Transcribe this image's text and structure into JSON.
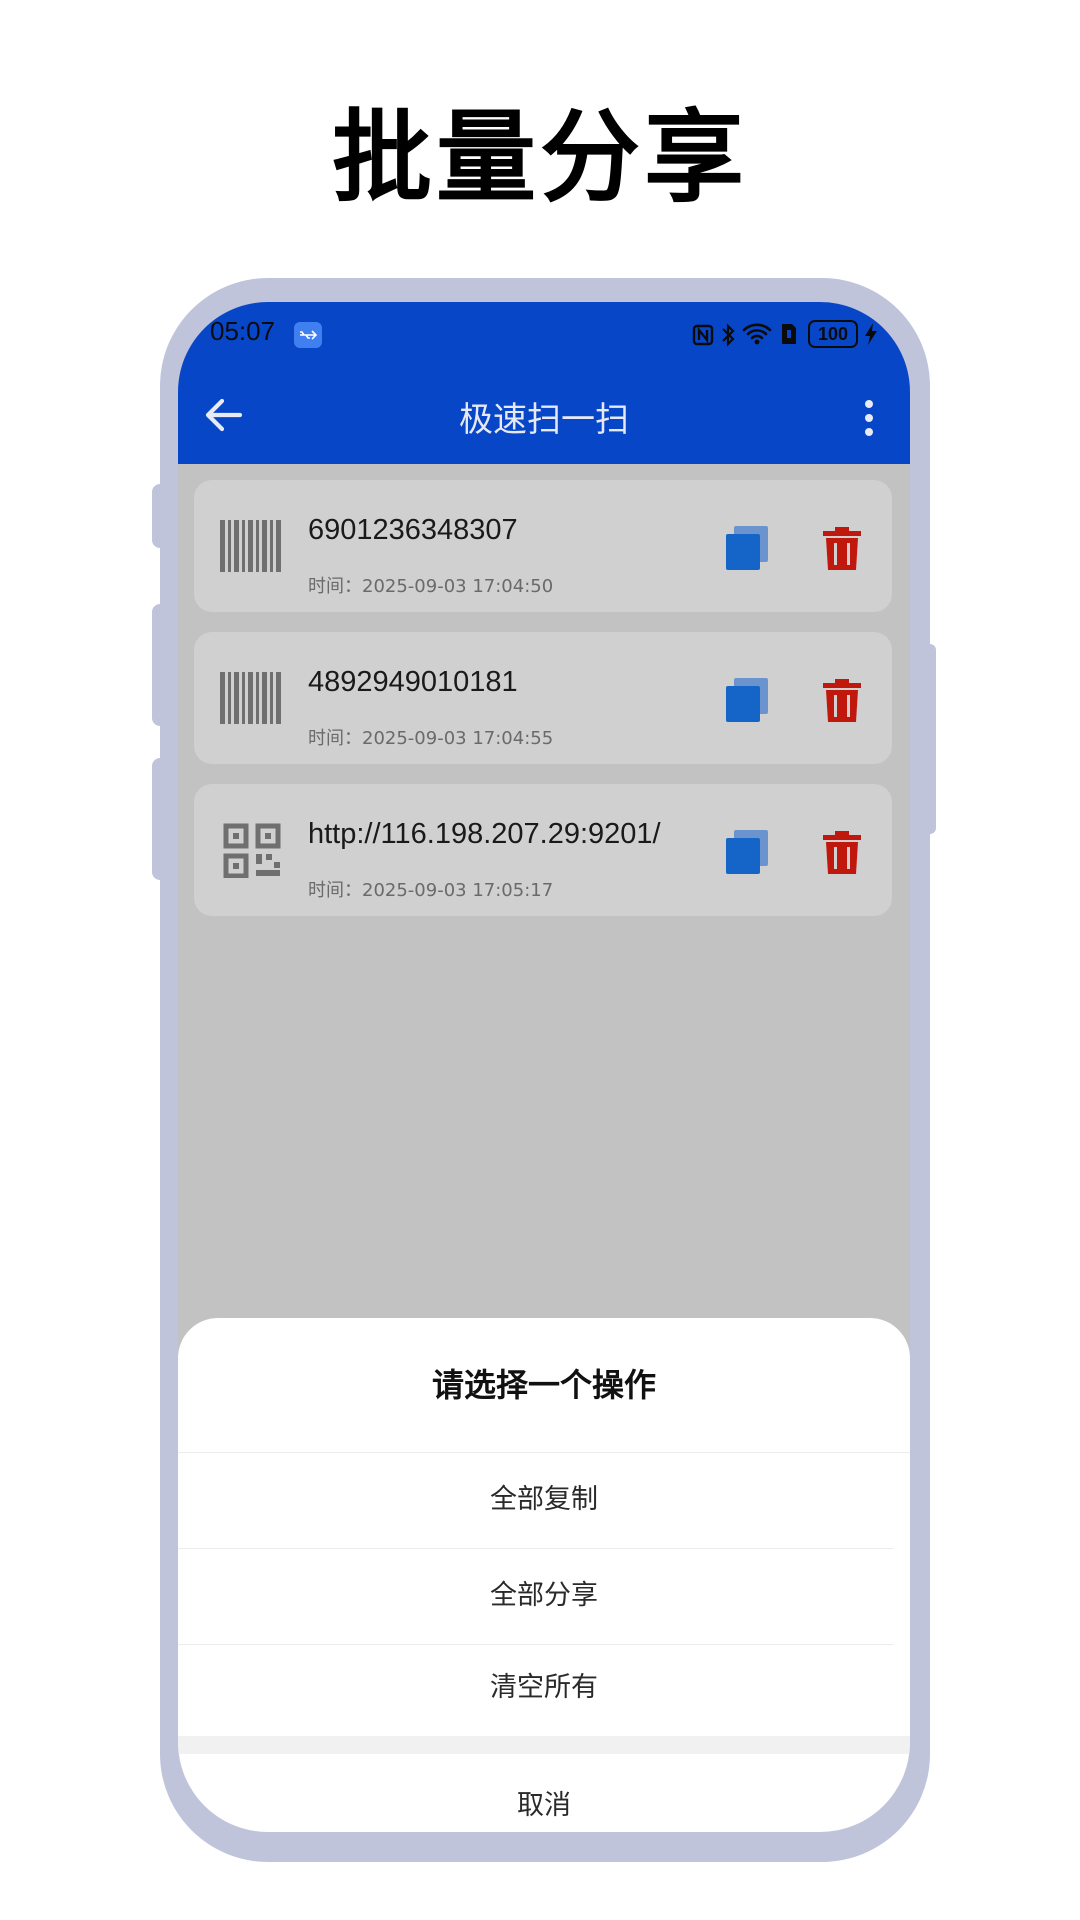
{
  "promo": {
    "title": "批量分享"
  },
  "status_bar": {
    "time": "05:07",
    "battery": "100"
  },
  "app_bar": {
    "title": "极速扫一扫"
  },
  "records": [
    {
      "type": "barcode",
      "value": "6901236348307",
      "time": "时间：2025-09-03 17:04:50"
    },
    {
      "type": "barcode",
      "value": "4892949010181",
      "time": "时间：2025-09-03 17:04:55"
    },
    {
      "type": "qrcode",
      "value": "http://116.198.207.29:9201/",
      "time": "时间：2025-09-03 17:05:17"
    }
  ],
  "action_sheet": {
    "title": "请选择一个操作",
    "options": [
      "全部复制",
      "全部分享",
      "清空所有"
    ],
    "cancel": "取消"
  },
  "colors": {
    "app_bar": "#0846c8",
    "copy_icon": "#1565c8",
    "delete_icon": "#c0180c",
    "phone_frame": "#bfc4db"
  },
  "icons": [
    "back-arrow-icon",
    "more-vert-icon",
    "barcode-icon",
    "qr-code-icon",
    "copy-icon",
    "trash-icon",
    "nfc-icon",
    "bluetooth-icon",
    "wifi-icon",
    "sim-icon",
    "battery-icon",
    "charging-icon",
    "usb-icon"
  ]
}
